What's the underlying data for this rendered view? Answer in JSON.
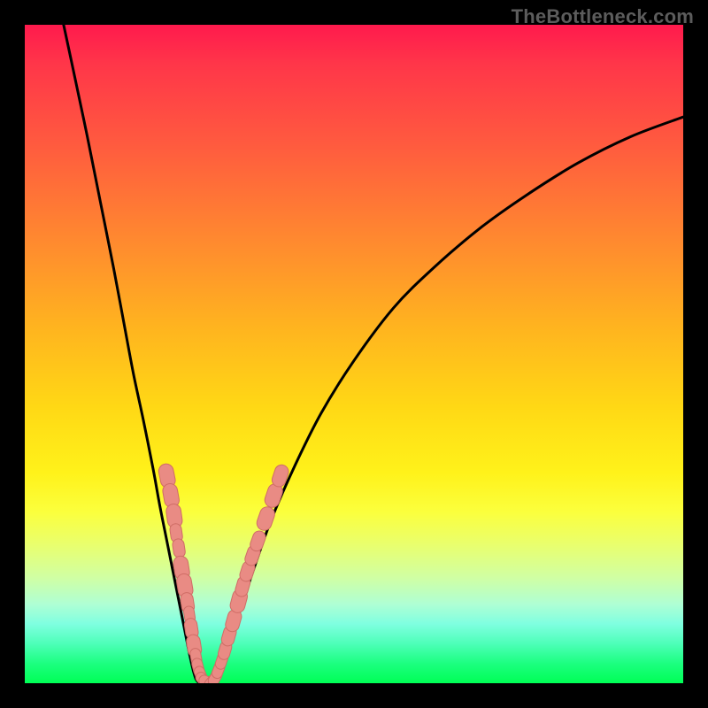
{
  "watermark": "TheBottleneck.com",
  "colors": {
    "frame": "#000000",
    "curve": "#000000",
    "markerFill": "#e98b84",
    "markerStroke": "#cf6d66"
  },
  "chart_data": {
    "type": "line",
    "title": "",
    "xlabel": "",
    "ylabel": "",
    "xlim": [
      0,
      100
    ],
    "ylim": [
      0,
      100
    ],
    "grid": false,
    "legend": false,
    "curve": [
      {
        "x": 5.9,
        "y": 100.0
      },
      {
        "x": 7.5,
        "y": 92.5
      },
      {
        "x": 9.5,
        "y": 83.0
      },
      {
        "x": 11.5,
        "y": 73.0
      },
      {
        "x": 13.5,
        "y": 63.0
      },
      {
        "x": 15.0,
        "y": 55.0
      },
      {
        "x": 16.5,
        "y": 47.0
      },
      {
        "x": 18.0,
        "y": 40.0
      },
      {
        "x": 19.5,
        "y": 32.5
      },
      {
        "x": 20.5,
        "y": 27.0
      },
      {
        "x": 21.5,
        "y": 22.0
      },
      {
        "x": 22.5,
        "y": 17.0
      },
      {
        "x": 23.5,
        "y": 12.0
      },
      {
        "x": 24.3,
        "y": 8.0
      },
      {
        "x": 25.0,
        "y": 4.5
      },
      {
        "x": 25.7,
        "y": 1.5
      },
      {
        "x": 26.3,
        "y": 0.2
      },
      {
        "x": 27.5,
        "y": 0.0
      },
      {
        "x": 28.7,
        "y": 0.2
      },
      {
        "x": 29.5,
        "y": 1.5
      },
      {
        "x": 30.5,
        "y": 4.0
      },
      {
        "x": 31.5,
        "y": 7.0
      },
      {
        "x": 33.0,
        "y": 12.0
      },
      {
        "x": 35.0,
        "y": 18.0
      },
      {
        "x": 37.5,
        "y": 25.0
      },
      {
        "x": 41.0,
        "y": 33.0
      },
      {
        "x": 45.0,
        "y": 41.0
      },
      {
        "x": 50.0,
        "y": 49.0
      },
      {
        "x": 56.0,
        "y": 57.0
      },
      {
        "x": 62.0,
        "y": 63.0
      },
      {
        "x": 69.0,
        "y": 69.0
      },
      {
        "x": 76.0,
        "y": 74.0
      },
      {
        "x": 84.0,
        "y": 79.0
      },
      {
        "x": 92.0,
        "y": 83.0
      },
      {
        "x": 100.0,
        "y": 86.0
      }
    ],
    "markers_left": [
      {
        "x": 21.6,
        "y": 31.5,
        "r": 1.4
      },
      {
        "x": 22.2,
        "y": 28.5,
        "r": 1.4
      },
      {
        "x": 22.7,
        "y": 25.4,
        "r": 1.4
      },
      {
        "x": 23.0,
        "y": 22.8,
        "r": 1.1
      },
      {
        "x": 23.4,
        "y": 20.5,
        "r": 1.1
      },
      {
        "x": 23.8,
        "y": 17.5,
        "r": 1.4
      },
      {
        "x": 24.3,
        "y": 14.8,
        "r": 1.4
      },
      {
        "x": 24.7,
        "y": 12.2,
        "r": 1.2
      },
      {
        "x": 25.0,
        "y": 10.4,
        "r": 1.0
      },
      {
        "x": 25.3,
        "y": 8.3,
        "r": 1.2
      },
      {
        "x": 25.7,
        "y": 5.7,
        "r": 1.3
      },
      {
        "x": 26.0,
        "y": 4.0,
        "r": 1.0
      },
      {
        "x": 26.3,
        "y": 2.5,
        "r": 1.0
      },
      {
        "x": 26.7,
        "y": 1.3,
        "r": 1.0
      },
      {
        "x": 27.1,
        "y": 0.5,
        "r": 1.0
      },
      {
        "x": 27.7,
        "y": 0.2,
        "r": 1.0
      }
    ],
    "markers_right": [
      {
        "x": 28.4,
        "y": 0.2,
        "r": 1.0
      },
      {
        "x": 28.9,
        "y": 0.8,
        "r": 1.0
      },
      {
        "x": 29.4,
        "y": 2.0,
        "r": 1.0
      },
      {
        "x": 29.9,
        "y": 3.4,
        "r": 1.0
      },
      {
        "x": 30.4,
        "y": 5.0,
        "r": 1.1
      },
      {
        "x": 31.0,
        "y": 7.2,
        "r": 1.2
      },
      {
        "x": 31.7,
        "y": 9.5,
        "r": 1.3
      },
      {
        "x": 32.5,
        "y": 12.5,
        "r": 1.4
      },
      {
        "x": 33.1,
        "y": 14.7,
        "r": 1.2
      },
      {
        "x": 33.8,
        "y": 17.0,
        "r": 1.2
      },
      {
        "x": 34.6,
        "y": 19.4,
        "r": 1.2
      },
      {
        "x": 35.4,
        "y": 21.6,
        "r": 1.2
      },
      {
        "x": 36.6,
        "y": 25.0,
        "r": 1.4
      },
      {
        "x": 37.8,
        "y": 28.5,
        "r": 1.4
      },
      {
        "x": 38.8,
        "y": 31.5,
        "r": 1.3
      }
    ]
  }
}
